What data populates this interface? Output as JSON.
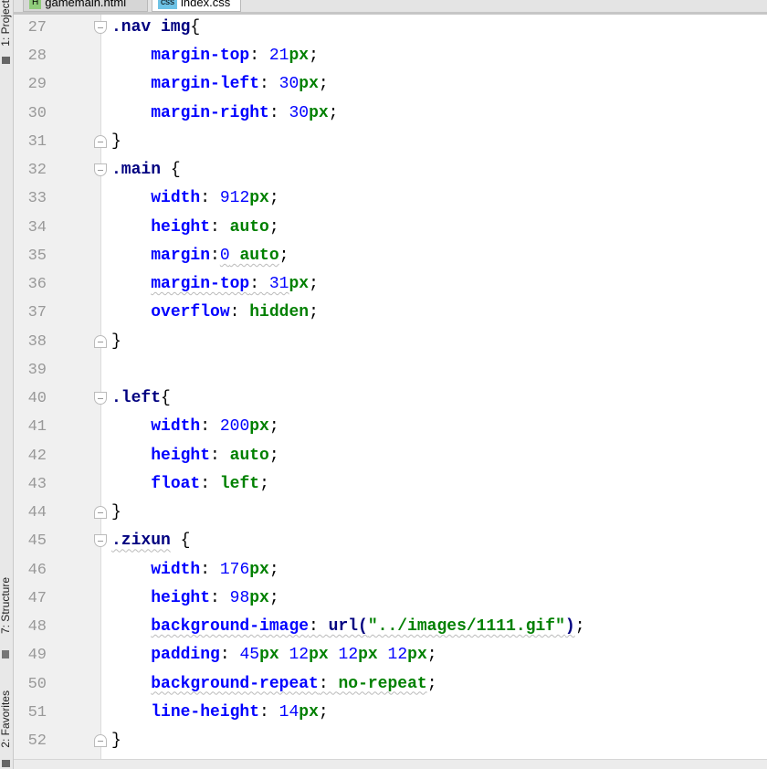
{
  "editor_tabs": [
    {
      "label": "gamemain.html",
      "icon": "H",
      "icon_color": "#8fcc7a",
      "active": false
    },
    {
      "label": "index.css",
      "icon": "css",
      "icon_color": "#6ec3e6",
      "active": true
    }
  ],
  "side_tools": {
    "project": "1: Project",
    "structure": "7: Structure",
    "favorites": "2: Favorites"
  },
  "colors": {
    "selector": "#000080",
    "property": "#0000ff",
    "number": "#0000ff",
    "unit": "#008000",
    "keyword": "#008000"
  },
  "lines": [
    {
      "num": "27",
      "fold": "open",
      "tokens": [
        {
          "t": ".nav img",
          "c": "sel"
        },
        {
          "t": "{",
          "c": "p"
        }
      ]
    },
    {
      "num": "28",
      "tokens": [
        {
          "t": "    "
        },
        {
          "t": "margin-top",
          "c": "prop"
        },
        {
          "t": ": ",
          "c": "p"
        },
        {
          "t": "21",
          "c": "numv"
        },
        {
          "t": "px",
          "c": "unit"
        },
        {
          "t": ";",
          "c": "p"
        }
      ]
    },
    {
      "num": "29",
      "tokens": [
        {
          "t": "    "
        },
        {
          "t": "margin-left",
          "c": "prop"
        },
        {
          "t": ": ",
          "c": "p"
        },
        {
          "t": "30",
          "c": "numv"
        },
        {
          "t": "px",
          "c": "unit"
        },
        {
          "t": ";",
          "c": "p"
        }
      ]
    },
    {
      "num": "30",
      "tokens": [
        {
          "t": "    "
        },
        {
          "t": "margin-right",
          "c": "prop"
        },
        {
          "t": ": ",
          "c": "p"
        },
        {
          "t": "30",
          "c": "numv"
        },
        {
          "t": "px",
          "c": "unit"
        },
        {
          "t": ";",
          "c": "p"
        }
      ]
    },
    {
      "num": "31",
      "fold": "close",
      "tokens": [
        {
          "t": "}",
          "c": "p"
        }
      ]
    },
    {
      "num": "32",
      "fold": "open",
      "tokens": [
        {
          "t": ".main ",
          "c": "sel"
        },
        {
          "t": "{",
          "c": "p"
        }
      ]
    },
    {
      "num": "33",
      "tokens": [
        {
          "t": "    "
        },
        {
          "t": "width",
          "c": "prop"
        },
        {
          "t": ": ",
          "c": "p"
        },
        {
          "t": "912",
          "c": "numv"
        },
        {
          "t": "px",
          "c": "unit"
        },
        {
          "t": ";",
          "c": "p"
        }
      ]
    },
    {
      "num": "34",
      "tokens": [
        {
          "t": "    "
        },
        {
          "t": "height",
          "c": "prop"
        },
        {
          "t": ": ",
          "c": "p"
        },
        {
          "t": "auto",
          "c": "kw"
        },
        {
          "t": ";",
          "c": "p"
        }
      ]
    },
    {
      "num": "35",
      "tokens": [
        {
          "t": "    "
        },
        {
          "t": "margin",
          "c": "prop"
        },
        {
          "t": ":",
          "c": "p"
        },
        {
          "t": "0",
          "c": "numv wavy"
        },
        {
          "t": " auto",
          "c": "kw wavy"
        },
        {
          "t": ";",
          "c": "p"
        }
      ]
    },
    {
      "num": "36",
      "tokens": [
        {
          "t": "    "
        },
        {
          "t": "margin-top",
          "c": "prop wavy"
        },
        {
          "t": ": ",
          "c": "p wavy"
        },
        {
          "t": "31",
          "c": "numv wavy"
        },
        {
          "t": "px",
          "c": "unit"
        },
        {
          "t": ";",
          "c": "p"
        }
      ]
    },
    {
      "num": "37",
      "tokens": [
        {
          "t": "    "
        },
        {
          "t": "overflow",
          "c": "prop"
        },
        {
          "t": ": ",
          "c": "p"
        },
        {
          "t": "hidden",
          "c": "kw"
        },
        {
          "t": ";",
          "c": "p"
        }
      ]
    },
    {
      "num": "38",
      "fold": "close",
      "tokens": [
        {
          "t": "}",
          "c": "p"
        }
      ]
    },
    {
      "num": "39",
      "tokens": []
    },
    {
      "num": "40",
      "fold": "open",
      "tokens": [
        {
          "t": ".left",
          "c": "sel"
        },
        {
          "t": "{",
          "c": "p"
        }
      ]
    },
    {
      "num": "41",
      "tokens": [
        {
          "t": "    "
        },
        {
          "t": "width",
          "c": "prop"
        },
        {
          "t": ": ",
          "c": "p"
        },
        {
          "t": "200",
          "c": "numv"
        },
        {
          "t": "px",
          "c": "unit"
        },
        {
          "t": ";",
          "c": "p"
        }
      ]
    },
    {
      "num": "42",
      "tokens": [
        {
          "t": "    "
        },
        {
          "t": "height",
          "c": "prop"
        },
        {
          "t": ": ",
          "c": "p"
        },
        {
          "t": "auto",
          "c": "kw"
        },
        {
          "t": ";",
          "c": "p"
        }
      ]
    },
    {
      "num": "43",
      "tokens": [
        {
          "t": "    "
        },
        {
          "t": "float",
          "c": "prop"
        },
        {
          "t": ": ",
          "c": "p"
        },
        {
          "t": "left",
          "c": "kw"
        },
        {
          "t": ";",
          "c": "p"
        }
      ]
    },
    {
      "num": "44",
      "fold": "close",
      "tokens": [
        {
          "t": "}",
          "c": "p"
        }
      ]
    },
    {
      "num": "45",
      "fold": "open",
      "tokens": [
        {
          "t": ".zixun",
          "c": "sel wavy"
        },
        {
          "t": " {",
          "c": "p"
        }
      ]
    },
    {
      "num": "46",
      "tokens": [
        {
          "t": "    "
        },
        {
          "t": "width",
          "c": "prop"
        },
        {
          "t": ": ",
          "c": "p"
        },
        {
          "t": "176",
          "c": "numv"
        },
        {
          "t": "px",
          "c": "unit"
        },
        {
          "t": ";",
          "c": "p"
        }
      ]
    },
    {
      "num": "47",
      "tokens": [
        {
          "t": "    "
        },
        {
          "t": "height",
          "c": "prop"
        },
        {
          "t": ": ",
          "c": "p"
        },
        {
          "t": "98",
          "c": "numv"
        },
        {
          "t": "px",
          "c": "unit"
        },
        {
          "t": ";",
          "c": "p"
        }
      ]
    },
    {
      "num": "48",
      "tokens": [
        {
          "t": "    "
        },
        {
          "t": "background-image",
          "c": "prop wavy"
        },
        {
          "t": ": ",
          "c": "p wavy"
        },
        {
          "t": "url(",
          "c": "fn wavy"
        },
        {
          "t": "\"../images/1111.gif\"",
          "c": "str wavy"
        },
        {
          "t": ")",
          "c": "fn wavy"
        },
        {
          "t": ";",
          "c": "p"
        }
      ]
    },
    {
      "num": "49",
      "tokens": [
        {
          "t": "    "
        },
        {
          "t": "padding",
          "c": "prop"
        },
        {
          "t": ": ",
          "c": "p"
        },
        {
          "t": "45",
          "c": "numv"
        },
        {
          "t": "px",
          "c": "unit"
        },
        {
          "t": " "
        },
        {
          "t": "12",
          "c": "numv"
        },
        {
          "t": "px",
          "c": "unit"
        },
        {
          "t": " "
        },
        {
          "t": "12",
          "c": "numv"
        },
        {
          "t": "px",
          "c": "unit"
        },
        {
          "t": " "
        },
        {
          "t": "12",
          "c": "numv"
        },
        {
          "t": "px",
          "c": "unit"
        },
        {
          "t": ";",
          "c": "p"
        }
      ]
    },
    {
      "num": "50",
      "tokens": [
        {
          "t": "    "
        },
        {
          "t": "background-repeat",
          "c": "prop wavy"
        },
        {
          "t": ": ",
          "c": "p wavy"
        },
        {
          "t": "no-repeat",
          "c": "kw wavy"
        },
        {
          "t": ";",
          "c": "p"
        }
      ]
    },
    {
      "num": "51",
      "tokens": [
        {
          "t": "    "
        },
        {
          "t": "line-height",
          "c": "prop"
        },
        {
          "t": ": ",
          "c": "p"
        },
        {
          "t": "14",
          "c": "numv"
        },
        {
          "t": "px",
          "c": "unit"
        },
        {
          "t": ";",
          "c": "p"
        }
      ]
    },
    {
      "num": "52",
      "fold": "close",
      "tokens": [
        {
          "t": "}",
          "c": "p"
        }
      ]
    }
  ]
}
